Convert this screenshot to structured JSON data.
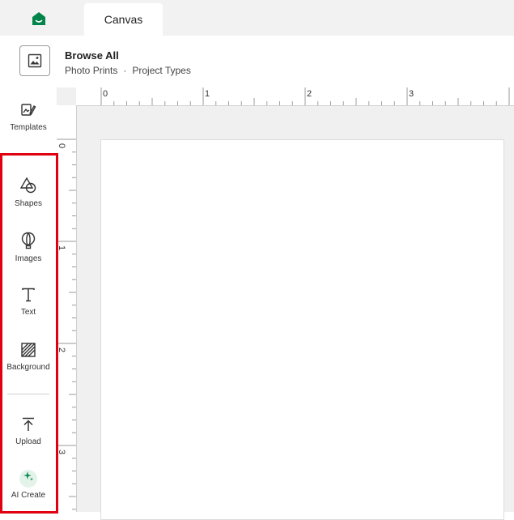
{
  "topbar": {
    "tab_label": "Canvas",
    "brand_color": "#00844a"
  },
  "header": {
    "title": "Browse All",
    "breadcrumb": [
      "Photo Prints",
      "Project Types"
    ]
  },
  "sidebar": {
    "items": [
      {
        "label": "Templates",
        "icon": "templates-icon"
      },
      {
        "label": "Shapes",
        "icon": "shapes-icon"
      },
      {
        "label": "Images",
        "icon": "images-icon"
      },
      {
        "label": "Text",
        "icon": "text-icon"
      },
      {
        "label": "Background",
        "icon": "background-icon"
      },
      {
        "label": "Upload",
        "icon": "upload-icon"
      },
      {
        "label": "AI Create",
        "icon": "ai-sparkle-icon"
      }
    ],
    "highlight_color": "#e0000f"
  },
  "rulers": {
    "top_labels": [
      "0",
      "1",
      "2",
      "3"
    ],
    "left_labels": [
      "0",
      "1",
      "2",
      "3"
    ]
  }
}
